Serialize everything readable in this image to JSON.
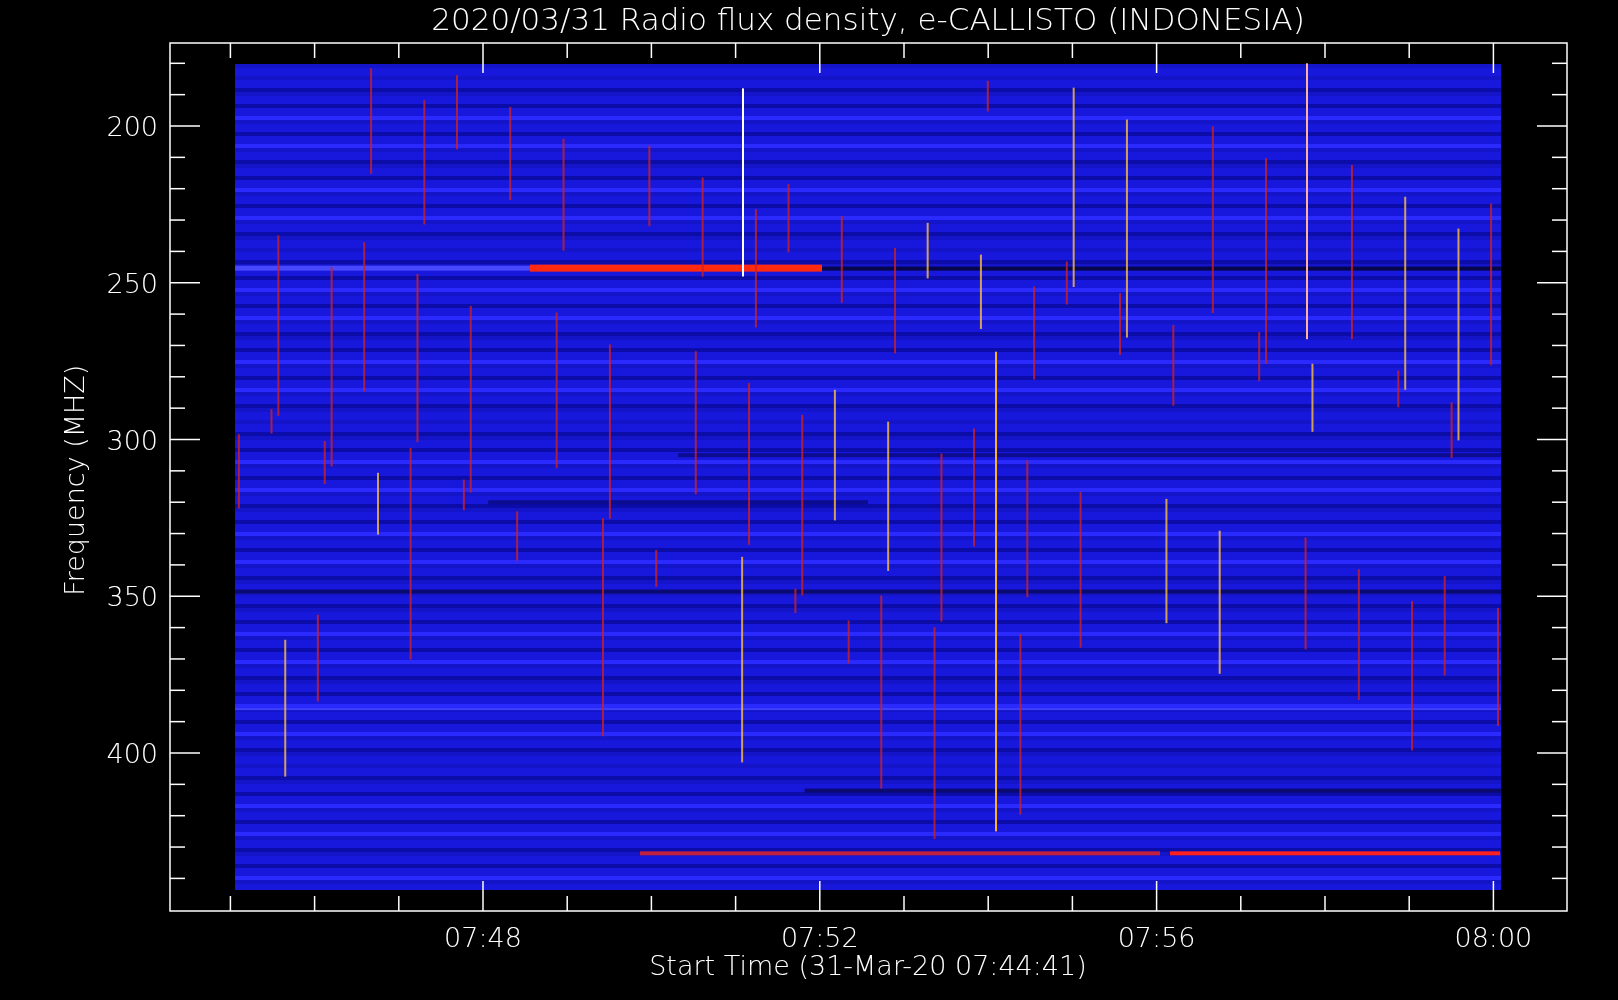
{
  "plot": {
    "title": "2020/03/31  Radio flux density, e-CALLISTO (INDONESIA)",
    "ylabel": "Frequency (MHZ)",
    "xlabel": "Start Time (31-Mar-20 07:44:41)",
    "y_tick_labels": [
      "200",
      "250",
      "300",
      "350",
      "400"
    ],
    "x_tick_labels": [
      "07:48",
      "07:52",
      "07:56",
      "08:00"
    ]
  }
}
